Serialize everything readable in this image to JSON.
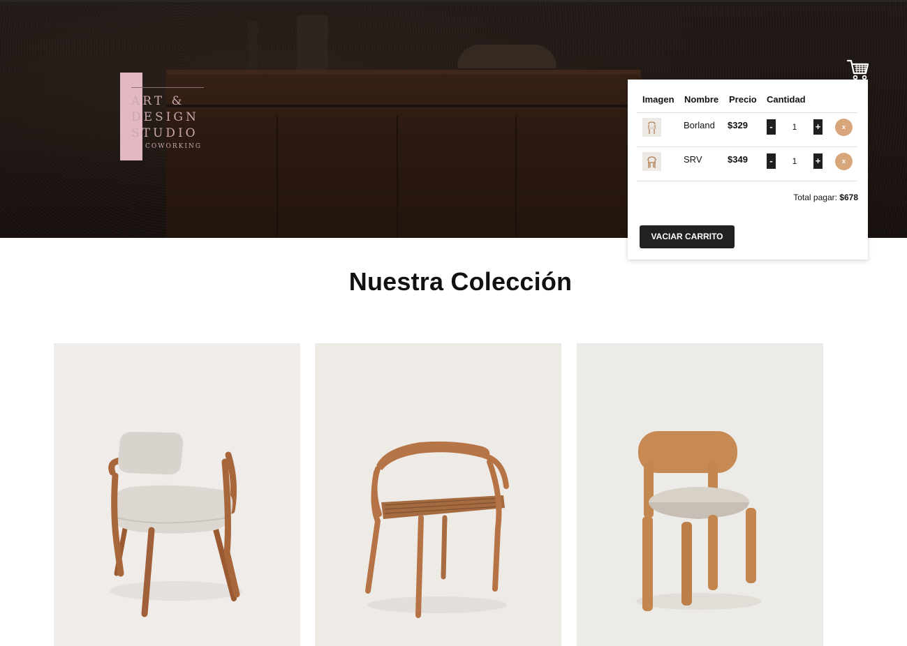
{
  "brand": {
    "line1": "ART &",
    "line2": "DESIGN",
    "line3": "STUDIO",
    "line4": "COWORKING",
    "accent": "#e3b8c0"
  },
  "header": {
    "cart_icon": "shopping-cart-icon"
  },
  "cart": {
    "columns": [
      "Imagen",
      "Nombre",
      "Precio",
      "Cantidad"
    ],
    "items": [
      {
        "name": "Borland",
        "price": "$329",
        "quantity": "1",
        "minus": "-",
        "plus": "+",
        "remove": "x"
      },
      {
        "name": "SRV",
        "price": "$349",
        "quantity": "1",
        "minus": "-",
        "plus": "+",
        "remove": "x"
      }
    ],
    "total_label": "Total pagar:",
    "total_value": "$678",
    "empty_button": "VACIAR CARRITO",
    "remove_color": "#d7a77b"
  },
  "main": {
    "section_title": "Nuestra Colección",
    "products": [
      {
        "image": "upholstered-armchair-image"
      },
      {
        "image": "wooden-armchair-image"
      },
      {
        "image": "wooden-chair-image"
      }
    ]
  }
}
